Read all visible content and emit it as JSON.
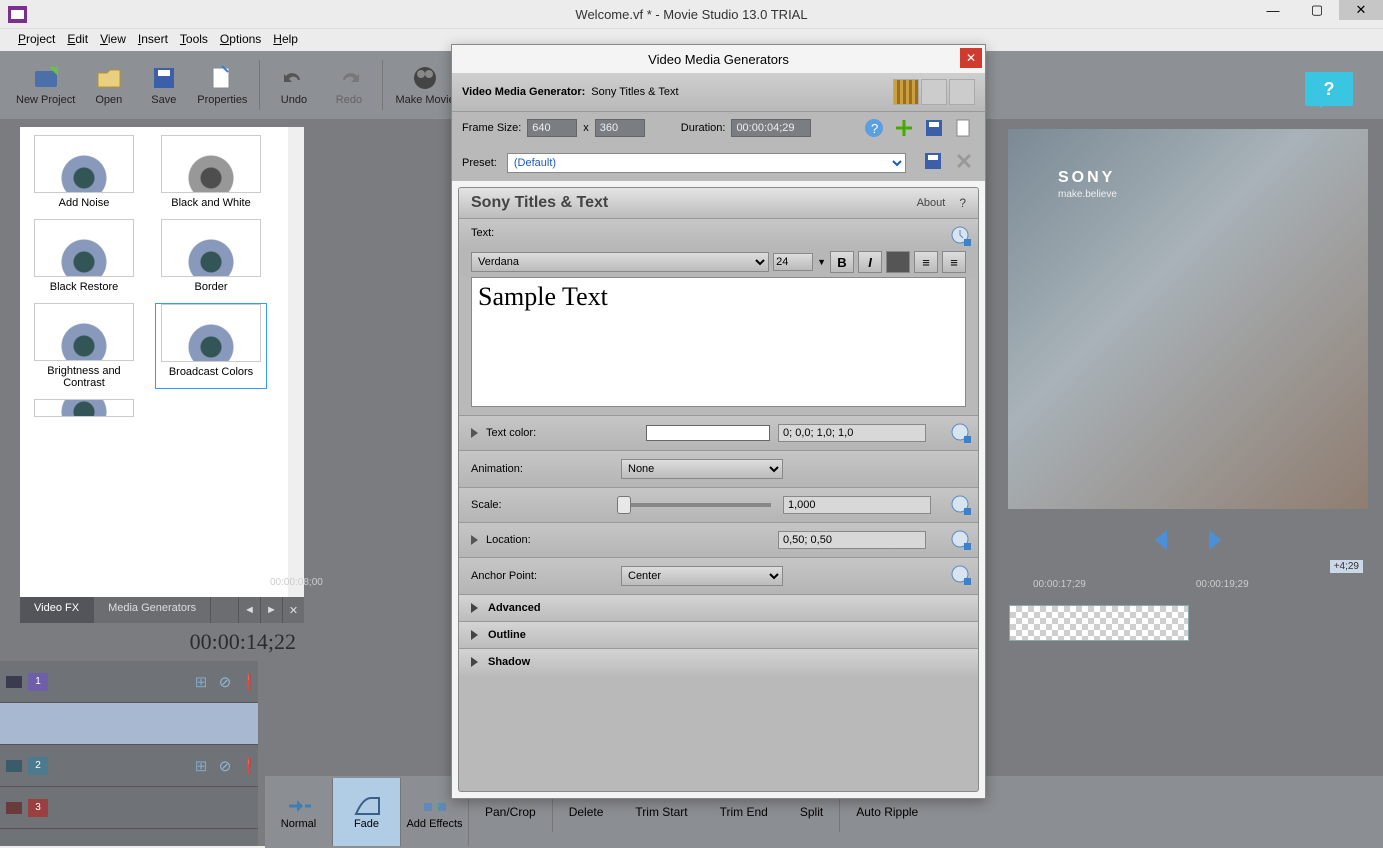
{
  "window": {
    "title": "Welcome.vf * - Movie Studio 13.0 TRIAL"
  },
  "menu": [
    "Project",
    "Edit",
    "View",
    "Insert",
    "Tools",
    "Options",
    "Help"
  ],
  "toolbar": {
    "new": "New Project",
    "open": "Open",
    "save": "Save",
    "props": "Properties",
    "undo": "Undo",
    "redo": "Redo",
    "make": "Make Movie"
  },
  "fx": {
    "items": [
      [
        "Add Noise",
        "Black and White"
      ],
      [
        "Black Restore",
        "Border"
      ],
      [
        "Brightness and Contrast",
        "Broadcast Colors"
      ]
    ],
    "tabs": {
      "videofx": "Video FX",
      "mediagen": "Media Generators"
    }
  },
  "timecode": "00:00:14;22",
  "ruler": {
    "t1": "00:00:08;00",
    "t2": "00:00:17;29",
    "t3": "00:00:19;29",
    "marker": "+4;29"
  },
  "cmds": {
    "normal": "Normal",
    "fade": "Fade",
    "addfx": "Add Effects",
    "pan": "Pan/Crop",
    "del": "Delete",
    "trimstart": "Trim Start",
    "trimend": "Trim End",
    "split": "Split",
    "auto": "Auto Ripple"
  },
  "preview": {
    "brand": "SONY",
    "tag": "make.believe"
  },
  "dialog": {
    "title": "Video Media Generators",
    "head_label": "Video Media Generator:",
    "head_value": "Sony Titles & Text",
    "framesize": "Frame Size:",
    "fw": "640",
    "fh": "360",
    "x": "x",
    "duration_label": "Duration:",
    "duration": "00:00:04;29",
    "preset_label": "Preset:",
    "preset": "(Default)",
    "panel_title": "Sony Titles & Text",
    "about": "About",
    "q": "?",
    "text_label": "Text:",
    "font": "Verdana",
    "size": "24",
    "sample": "Sample Text",
    "textcolor": "Text color:",
    "textcolor_v": "0; 0,0; 1,0; 1,0",
    "animation": "Animation:",
    "animation_v": "None",
    "scale": "Scale:",
    "scale_v": "1,000",
    "location": "Location:",
    "location_v": "0,50; 0,50",
    "anchor": "Anchor Point:",
    "anchor_v": "Center",
    "advanced": "Advanced",
    "outline": "Outline",
    "shadow": "Shadow"
  }
}
